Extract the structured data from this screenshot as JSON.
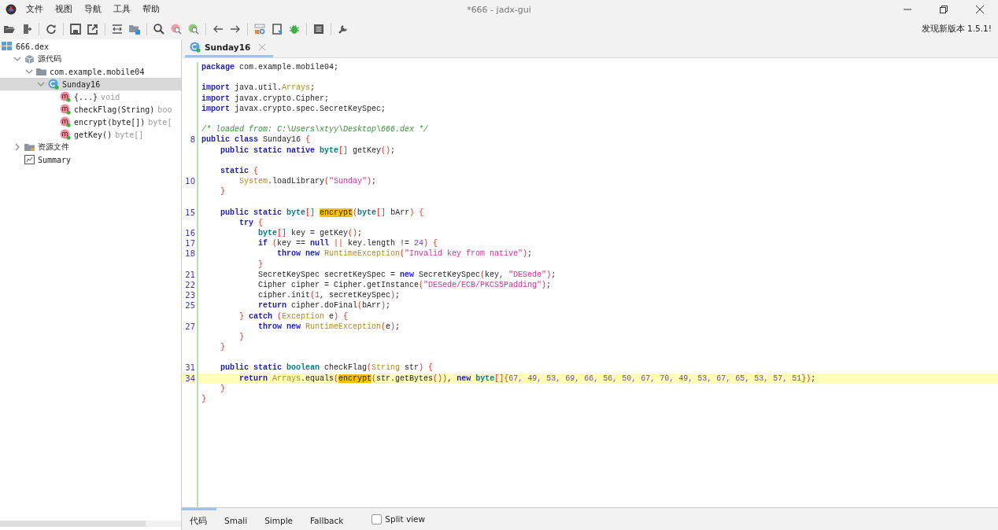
{
  "window": {
    "title": "*666 - jadx-gui"
  },
  "menu": [
    "文件",
    "视图",
    "导航",
    "工具",
    "帮助"
  ],
  "update_notice": "发现新版本 1.5.1!",
  "tree": [
    {
      "label": "666.dex",
      "kind": "dex",
      "selected": false,
      "children": [
        {
          "label": "源代码",
          "kind": "sources",
          "expanded": true,
          "selected": false,
          "children": [
            {
              "label": "com.example.mobile04",
              "kind": "package",
              "expanded": true,
              "selected": false,
              "children": [
                {
                  "label": "Sunday16",
                  "kind": "class",
                  "expanded": true,
                  "selected": true,
                  "children": [
                    {
                      "label": "{...}",
                      "detail": "void",
                      "kind": "method",
                      "selected": false
                    },
                    {
                      "label": "checkFlag(String)",
                      "detail": "boo",
                      "kind": "method",
                      "selected": false
                    },
                    {
                      "label": "encrypt(byte[])",
                      "detail": "byte[",
                      "kind": "method",
                      "selected": false
                    },
                    {
                      "label": "getKey()",
                      "detail": "byte[]",
                      "kind": "method",
                      "selected": false
                    }
                  ]
                }
              ]
            }
          ]
        },
        {
          "label": "资源文件",
          "kind": "resources",
          "expanded": false,
          "selected": false
        },
        {
          "label": "Summary",
          "kind": "summary",
          "selected": false
        }
      ]
    }
  ],
  "editor_tabs": [
    {
      "label": "Sunday16",
      "selected": true
    }
  ],
  "code": [
    {
      "kind": "code",
      "tokens": [
        {
          "kind": "kw",
          "text": "package"
        },
        {
          "kind": "plain",
          "text": " com.example.mobile04;"
        }
      ]
    },
    {
      "kind": "blank"
    },
    {
      "kind": "code",
      "tokens": [
        {
          "kind": "kw",
          "text": "import"
        },
        {
          "kind": "plain",
          "text": " java.util."
        },
        {
          "kind": "cls",
          "text": "Arrays"
        },
        {
          "kind": "plain",
          "text": ";"
        }
      ]
    },
    {
      "kind": "code",
      "tokens": [
        {
          "kind": "kw",
          "text": "import"
        },
        {
          "kind": "plain",
          "text": " javax.crypto.Cipher;"
        }
      ]
    },
    {
      "kind": "code",
      "tokens": [
        {
          "kind": "kw",
          "text": "import"
        },
        {
          "kind": "plain",
          "text": " javax.crypto.spec.SecretKeySpec;"
        }
      ]
    },
    {
      "kind": "blank"
    },
    {
      "kind": "code",
      "tokens": [
        {
          "kind": "comment",
          "text": "/* loaded from: C:\\Users\\xtyy\\Desktop\\666.dex */"
        }
      ]
    },
    {
      "kind": "code",
      "number": "8",
      "tokens": [
        {
          "kind": "kw",
          "text": "public class"
        },
        {
          "kind": "plain",
          "text": " Sunday16 "
        },
        {
          "kind": "brace",
          "text": "{"
        }
      ]
    },
    {
      "kind": "code",
      "tokens": [
        {
          "kind": "kw",
          "text": "    public static native "
        },
        {
          "kind": "type",
          "text": "byte"
        },
        {
          "kind": "brace",
          "text": "[]"
        },
        {
          "kind": "plain",
          "text": " getKey"
        },
        {
          "kind": "brace",
          "text": "()"
        },
        {
          "kind": "plain",
          "text": ";"
        }
      ]
    },
    {
      "kind": "blank"
    },
    {
      "kind": "code",
      "tokens": [
        {
          "kind": "kw",
          "text": "    static "
        },
        {
          "kind": "brace",
          "text": "{"
        }
      ]
    },
    {
      "kind": "code",
      "number": "10",
      "tokens": [
        {
          "kind": "cls",
          "text": "        System"
        },
        {
          "kind": "plain",
          "text": ".loadLibrary"
        },
        {
          "kind": "brace",
          "text": "("
        },
        {
          "kind": "str",
          "text": "\"Sunday\""
        },
        {
          "kind": "brace",
          "text": ")"
        },
        {
          "kind": "plain",
          "text": ";"
        }
      ]
    },
    {
      "kind": "code",
      "tokens": [
        {
          "kind": "brace",
          "text": "    }"
        }
      ]
    },
    {
      "kind": "blank"
    },
    {
      "kind": "code",
      "number": "15",
      "tokens": [
        {
          "kind": "kw",
          "text": "    public static "
        },
        {
          "kind": "type",
          "text": "byte"
        },
        {
          "kind": "brace",
          "text": "[] "
        },
        {
          "kind": "hl",
          "text": "encrypt"
        },
        {
          "kind": "brace",
          "text": "("
        },
        {
          "kind": "type",
          "text": "byte"
        },
        {
          "kind": "brace",
          "text": "[]"
        },
        {
          "kind": "plain",
          "text": " bArr"
        },
        {
          "kind": "brace",
          "text": ") {"
        }
      ]
    },
    {
      "kind": "code",
      "tokens": [
        {
          "kind": "kw",
          "text": "        try "
        },
        {
          "kind": "brace",
          "text": "{"
        }
      ]
    },
    {
      "kind": "code",
      "number": "16",
      "tokens": [
        {
          "kind": "type",
          "text": "            byte"
        },
        {
          "kind": "brace",
          "text": "[]"
        },
        {
          "kind": "plain",
          "text": " key = getKey"
        },
        {
          "kind": "brace",
          "text": "()"
        },
        {
          "kind": "plain",
          "text": ";"
        }
      ]
    },
    {
      "kind": "code",
      "number": "17",
      "tokens": [
        {
          "kind": "kw",
          "text": "            if "
        },
        {
          "kind": "brace",
          "text": "("
        },
        {
          "kind": "plain",
          "text": "key == "
        },
        {
          "kind": "kw",
          "text": "null "
        },
        {
          "kind": "brace",
          "text": "||"
        },
        {
          "kind": "plain",
          "text": " key.length != "
        },
        {
          "kind": "num",
          "text": "24"
        },
        {
          "kind": "brace",
          "text": ") {"
        }
      ]
    },
    {
      "kind": "code",
      "number": "18",
      "tokens": [
        {
          "kind": "kw",
          "text": "                throw new "
        },
        {
          "kind": "cls",
          "text": "RuntimeException"
        },
        {
          "kind": "brace",
          "text": "("
        },
        {
          "kind": "str",
          "text": "\"Invalid key from native\""
        },
        {
          "kind": "brace",
          "text": ")"
        },
        {
          "kind": "plain",
          "text": ";"
        }
      ]
    },
    {
      "kind": "code",
      "tokens": [
        {
          "kind": "brace",
          "text": "            }"
        }
      ]
    },
    {
      "kind": "code",
      "number": "21",
      "tokens": [
        {
          "kind": "plain",
          "text": "            SecretKeySpec secretKeySpec = "
        },
        {
          "kind": "kw",
          "text": "new"
        },
        {
          "kind": "plain",
          "text": " SecretKeySpec"
        },
        {
          "kind": "brace",
          "text": "("
        },
        {
          "kind": "plain",
          "text": "key, "
        },
        {
          "kind": "str",
          "text": "\"DESede\""
        },
        {
          "kind": "brace",
          "text": ")"
        },
        {
          "kind": "plain",
          "text": ";"
        }
      ]
    },
    {
      "kind": "code",
      "number": "22",
      "tokens": [
        {
          "kind": "plain",
          "text": "            Cipher cipher = Cipher.getInstance"
        },
        {
          "kind": "brace",
          "text": "("
        },
        {
          "kind": "str",
          "text": "\"DESede/ECB/PKCS5Padding\""
        },
        {
          "kind": "brace",
          "text": ")"
        },
        {
          "kind": "plain",
          "text": ";"
        }
      ]
    },
    {
      "kind": "code",
      "number": "23",
      "tokens": [
        {
          "kind": "plain",
          "text": "            cipher.init"
        },
        {
          "kind": "brace",
          "text": "("
        },
        {
          "kind": "num",
          "text": "1"
        },
        {
          "kind": "plain",
          "text": ", secretKeySpec"
        },
        {
          "kind": "brace",
          "text": ")"
        },
        {
          "kind": "plain",
          "text": ";"
        }
      ]
    },
    {
      "kind": "code",
      "number": "25",
      "tokens": [
        {
          "kind": "kw",
          "text": "            return"
        },
        {
          "kind": "plain",
          "text": " cipher.doFinal"
        },
        {
          "kind": "brace",
          "text": "("
        },
        {
          "kind": "plain",
          "text": "bArr"
        },
        {
          "kind": "brace",
          "text": ")"
        },
        {
          "kind": "plain",
          "text": ";"
        }
      ]
    },
    {
      "kind": "code",
      "tokens": [
        {
          "kind": "brace",
          "text": "        } "
        },
        {
          "kind": "kw",
          "text": "catch "
        },
        {
          "kind": "brace",
          "text": "("
        },
        {
          "kind": "cls",
          "text": "Exception"
        },
        {
          "kind": "plain",
          "text": " e"
        },
        {
          "kind": "brace",
          "text": ") {"
        }
      ]
    },
    {
      "kind": "code",
      "number": "27",
      "tokens": [
        {
          "kind": "kw",
          "text": "            throw new "
        },
        {
          "kind": "cls",
          "text": "RuntimeException"
        },
        {
          "kind": "brace",
          "text": "("
        },
        {
          "kind": "plain",
          "text": "e"
        },
        {
          "kind": "brace",
          "text": ")"
        },
        {
          "kind": "plain",
          "text": ";"
        }
      ]
    },
    {
      "kind": "code",
      "tokens": [
        {
          "kind": "brace",
          "text": "        }"
        }
      ]
    },
    {
      "kind": "code",
      "tokens": [
        {
          "kind": "brace",
          "text": "    }"
        }
      ]
    },
    {
      "kind": "blank"
    },
    {
      "kind": "code",
      "number": "31",
      "tokens": [
        {
          "kind": "kw",
          "text": "    public static "
        },
        {
          "kind": "type",
          "text": "boolean"
        },
        {
          "kind": "plain",
          "text": " checkFlag"
        },
        {
          "kind": "brace",
          "text": "("
        },
        {
          "kind": "cls",
          "text": "String"
        },
        {
          "kind": "plain",
          "text": " str"
        },
        {
          "kind": "brace",
          "text": ") {"
        }
      ]
    },
    {
      "kind": "code",
      "number": "34",
      "current": true,
      "tokens": [
        {
          "kind": "kw",
          "text": "        return "
        },
        {
          "kind": "cls",
          "text": "Arrays"
        },
        {
          "kind": "plain",
          "text": ".equals"
        },
        {
          "kind": "brace",
          "text": "("
        },
        {
          "kind": "hl",
          "text": "encrypt"
        },
        {
          "kind": "brace",
          "text": "("
        },
        {
          "kind": "plain",
          "text": "str.getBytes"
        },
        {
          "kind": "brace",
          "text": "())"
        },
        {
          "kind": "plain",
          "text": ", "
        },
        {
          "kind": "kw",
          "text": "new "
        },
        {
          "kind": "type",
          "text": "byte"
        },
        {
          "kind": "brace",
          "text": "[]{"
        },
        {
          "kind": "num",
          "text": "67, 49, 53, 69, 66, 56, 50, 67, 70, 49, 53, 67, 65, 53, 57, 51"
        },
        {
          "kind": "brace",
          "text": "})"
        },
        {
          "kind": "plain",
          "text": ";"
        }
      ]
    },
    {
      "kind": "code",
      "tokens": [
        {
          "kind": "brace",
          "text": "    }"
        }
      ]
    },
    {
      "kind": "code",
      "tokens": [
        {
          "kind": "brace",
          "text": "}"
        }
      ]
    }
  ],
  "bottom_tabs": [
    {
      "label": "代码",
      "selected": true
    },
    {
      "label": "Smali",
      "selected": false
    },
    {
      "label": "Simple",
      "selected": false
    },
    {
      "label": "Fallback",
      "selected": false
    }
  ],
  "split_view": {
    "label": "Split view",
    "checked": false
  }
}
